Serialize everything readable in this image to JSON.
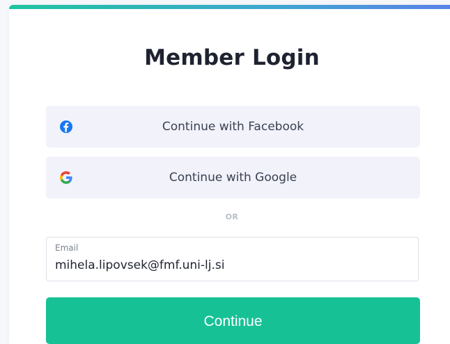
{
  "login": {
    "title": "Member Login",
    "facebook_label": "Continue with Facebook",
    "google_label": "Continue with Google",
    "divider_text": "OR",
    "email": {
      "label": "Email",
      "value": "mihela.lipovsek@fmf.uni-lj.si"
    },
    "continue_label": "Continue"
  },
  "colors": {
    "accent_green": "#16c195",
    "facebook_blue": "#1877f2",
    "social_button_bg": "#f1f2fa"
  },
  "icons": {
    "facebook": "facebook-icon",
    "google": "google-icon"
  }
}
